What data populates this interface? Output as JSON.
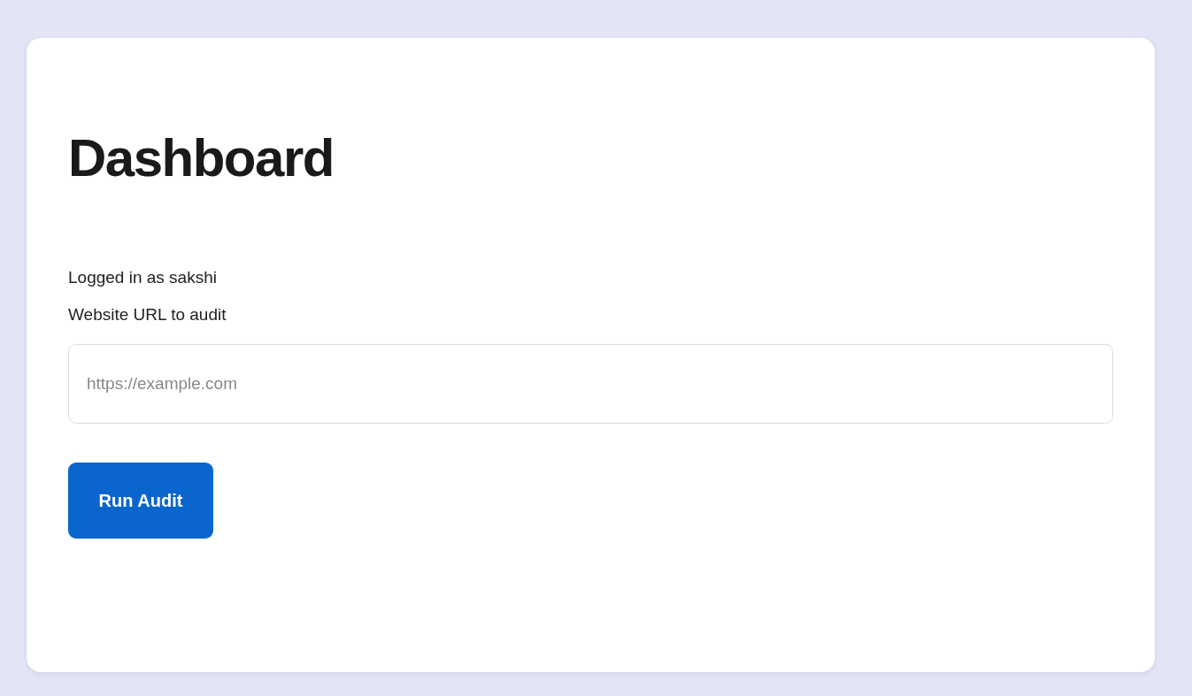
{
  "title": "Dashboard",
  "user_line": "Logged in as sakshi",
  "url_field": {
    "label": "Website URL to audit",
    "placeholder": "https://example.com"
  },
  "button": "Run Audit"
}
